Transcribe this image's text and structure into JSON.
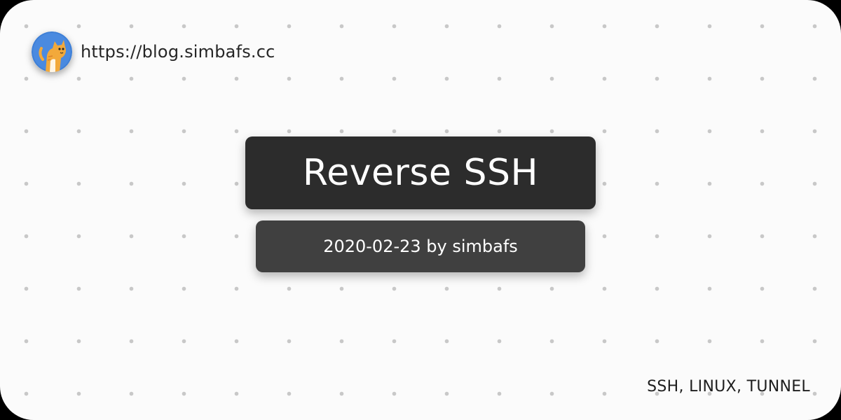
{
  "site": {
    "url": "https://blog.simbafs.cc",
    "avatar_icon": "cat-avatar-icon"
  },
  "post": {
    "title": "Reverse SSH",
    "meta": "2020-02-23 by simbafs",
    "tags": "SSH, LINUX, TUNNEL"
  },
  "colors": {
    "background": "#fbfbfb",
    "dots": "#c8c8c8",
    "title_box": "#2c2c2c",
    "meta_box": "#404040",
    "avatar_bg": "#3e7fd6",
    "avatar_cat": "#f2a93b"
  }
}
